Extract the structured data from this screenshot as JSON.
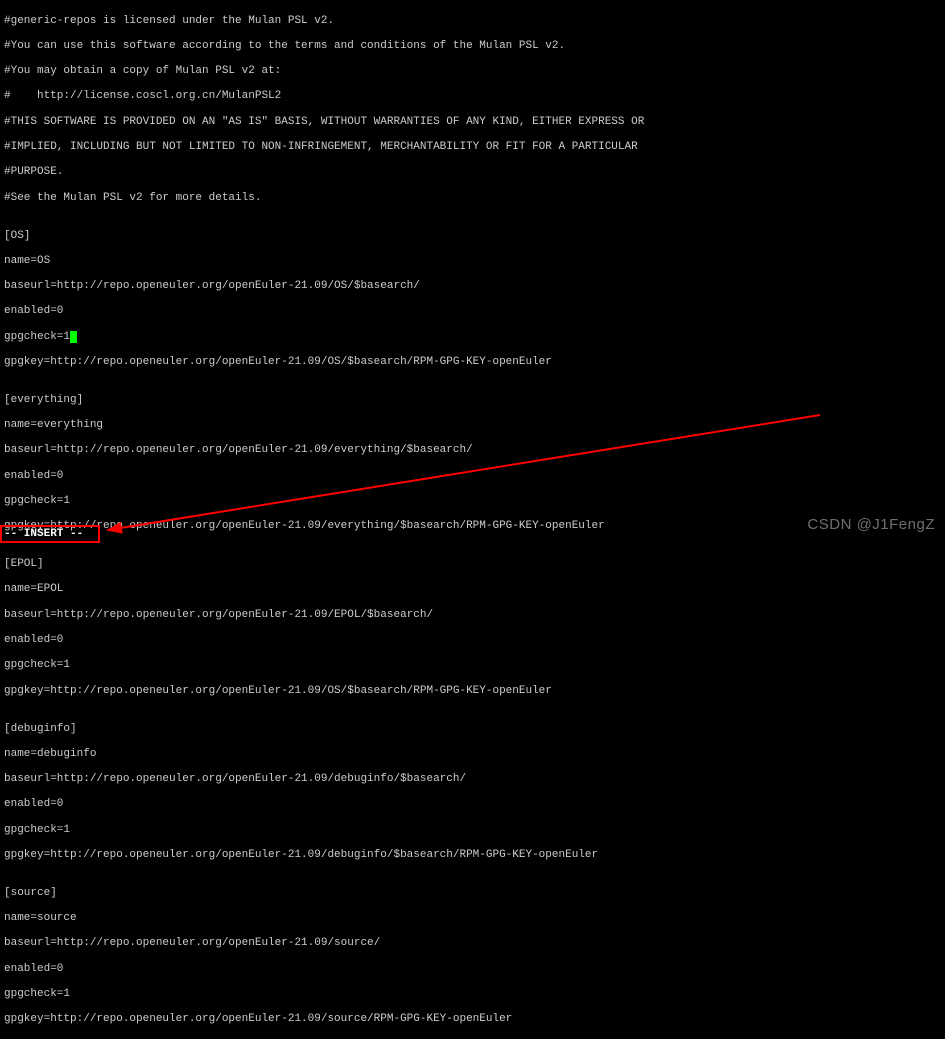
{
  "license_comments": [
    "#generic-repos is licensed under the Mulan PSL v2.",
    "#You can use this software according to the terms and conditions of the Mulan PSL v2.",
    "#You may obtain a copy of Mulan PSL v2 at:",
    "#    http://license.coscl.org.cn/MulanPSL2",
    "#THIS SOFTWARE IS PROVIDED ON AN \"AS IS\" BASIS, WITHOUT WARRANTIES OF ANY KIND, EITHER EXPRESS OR",
    "#IMPLIED, INCLUDING BUT NOT LIMITED TO NON-INFRINGEMENT, MERCHANTABILITY OR FIT FOR A PARTICULAR",
    "#PURPOSE.",
    "#See the Mulan PSL v2 for more details."
  ],
  "repos": {
    "os": {
      "header": "[OS]",
      "name": "name=OS",
      "baseurl": "baseurl=http://repo.openeuler.org/openEuler-21.09/OS/$basearch/",
      "enabled": "enabled=0",
      "gpgcheck_prefix": "gpgcheck=1",
      "gpgkey": "gpgkey=http://repo.openeuler.org/openEuler-21.09/OS/$basearch/RPM-GPG-KEY-openEuler"
    },
    "everything": {
      "header": "[everything]",
      "name": "name=everything",
      "baseurl": "baseurl=http://repo.openeuler.org/openEuler-21.09/everything/$basearch/",
      "enabled": "enabled=0",
      "gpgcheck": "gpgcheck=1",
      "gpgkey": "gpgkey=http://repo.openeuler.org/openEuler-21.09/everything/$basearch/RPM-GPG-KEY-openEuler"
    },
    "epol": {
      "header": "[EPOL]",
      "name": "name=EPOL",
      "baseurl": "baseurl=http://repo.openeuler.org/openEuler-21.09/EPOL/$basearch/",
      "enabled": "enabled=0",
      "gpgcheck": "gpgcheck=1",
      "gpgkey": "gpgkey=http://repo.openeuler.org/openEuler-21.09/OS/$basearch/RPM-GPG-KEY-openEuler"
    },
    "debuginfo": {
      "header": "[debuginfo]",
      "name": "name=debuginfo",
      "baseurl": "baseurl=http://repo.openeuler.org/openEuler-21.09/debuginfo/$basearch/",
      "enabled": "enabled=0",
      "gpgcheck": "gpgcheck=1",
      "gpgkey": "gpgkey=http://repo.openeuler.org/openEuler-21.09/debuginfo/$basearch/RPM-GPG-KEY-openEuler"
    },
    "source": {
      "header": "[source]",
      "name": "name=source",
      "baseurl": "baseurl=http://repo.openeuler.org/openEuler-21.09/source/",
      "enabled": "enabled=0",
      "gpgcheck": "gpgcheck=1",
      "gpgkey": "gpgkey=http://repo.openeuler.org/openEuler-21.09/source/RPM-GPG-KEY-openEuler"
    }
  },
  "blank": "",
  "vim_mode": "-- INSERT --",
  "watermark": "CSDN @J1FengZ",
  "annotation": {
    "box_color": "#ff0000",
    "arrow_color": "#ff0000"
  }
}
